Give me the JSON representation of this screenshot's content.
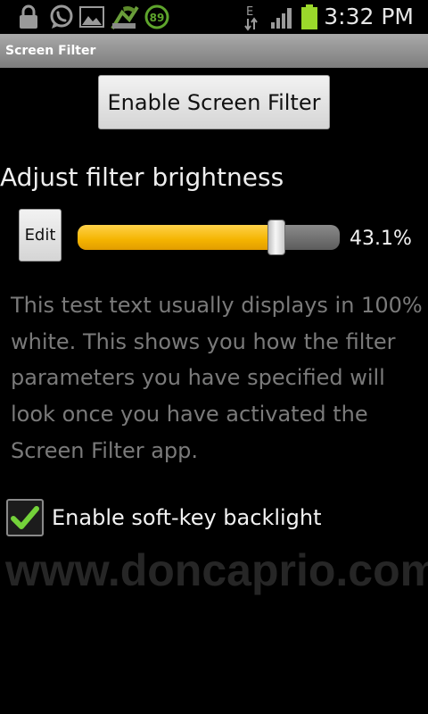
{
  "status_bar": {
    "time": "3:32 PM",
    "notification_count": "89",
    "network_type": "E",
    "icons": [
      "lock-icon",
      "whatsapp-icon",
      "gallery-icon",
      "weather-icon",
      "badge-icon",
      "network-type-icon",
      "signal-icon",
      "battery-icon"
    ],
    "battery_color": "#9bd82b"
  },
  "app": {
    "title": "Screen Filter"
  },
  "main": {
    "enable_button_label": "Enable Screen Filter",
    "brightness_heading": "Adjust filter brightness",
    "edit_button_label": "Edit",
    "brightness_value": "43.1%",
    "brightness_fraction": 0.76,
    "sample_text": "This test text usually displays in 100% white. This shows you how the filter parameters you have specified will look once you have activated the Screen Filter app.",
    "softkey_checkbox_label": "Enable soft-key backlight",
    "softkey_checked": true,
    "watermark": "www.doncaprio.com"
  },
  "colors": {
    "slider_fill": "#f4b400",
    "checkmark": "#74d23a"
  }
}
